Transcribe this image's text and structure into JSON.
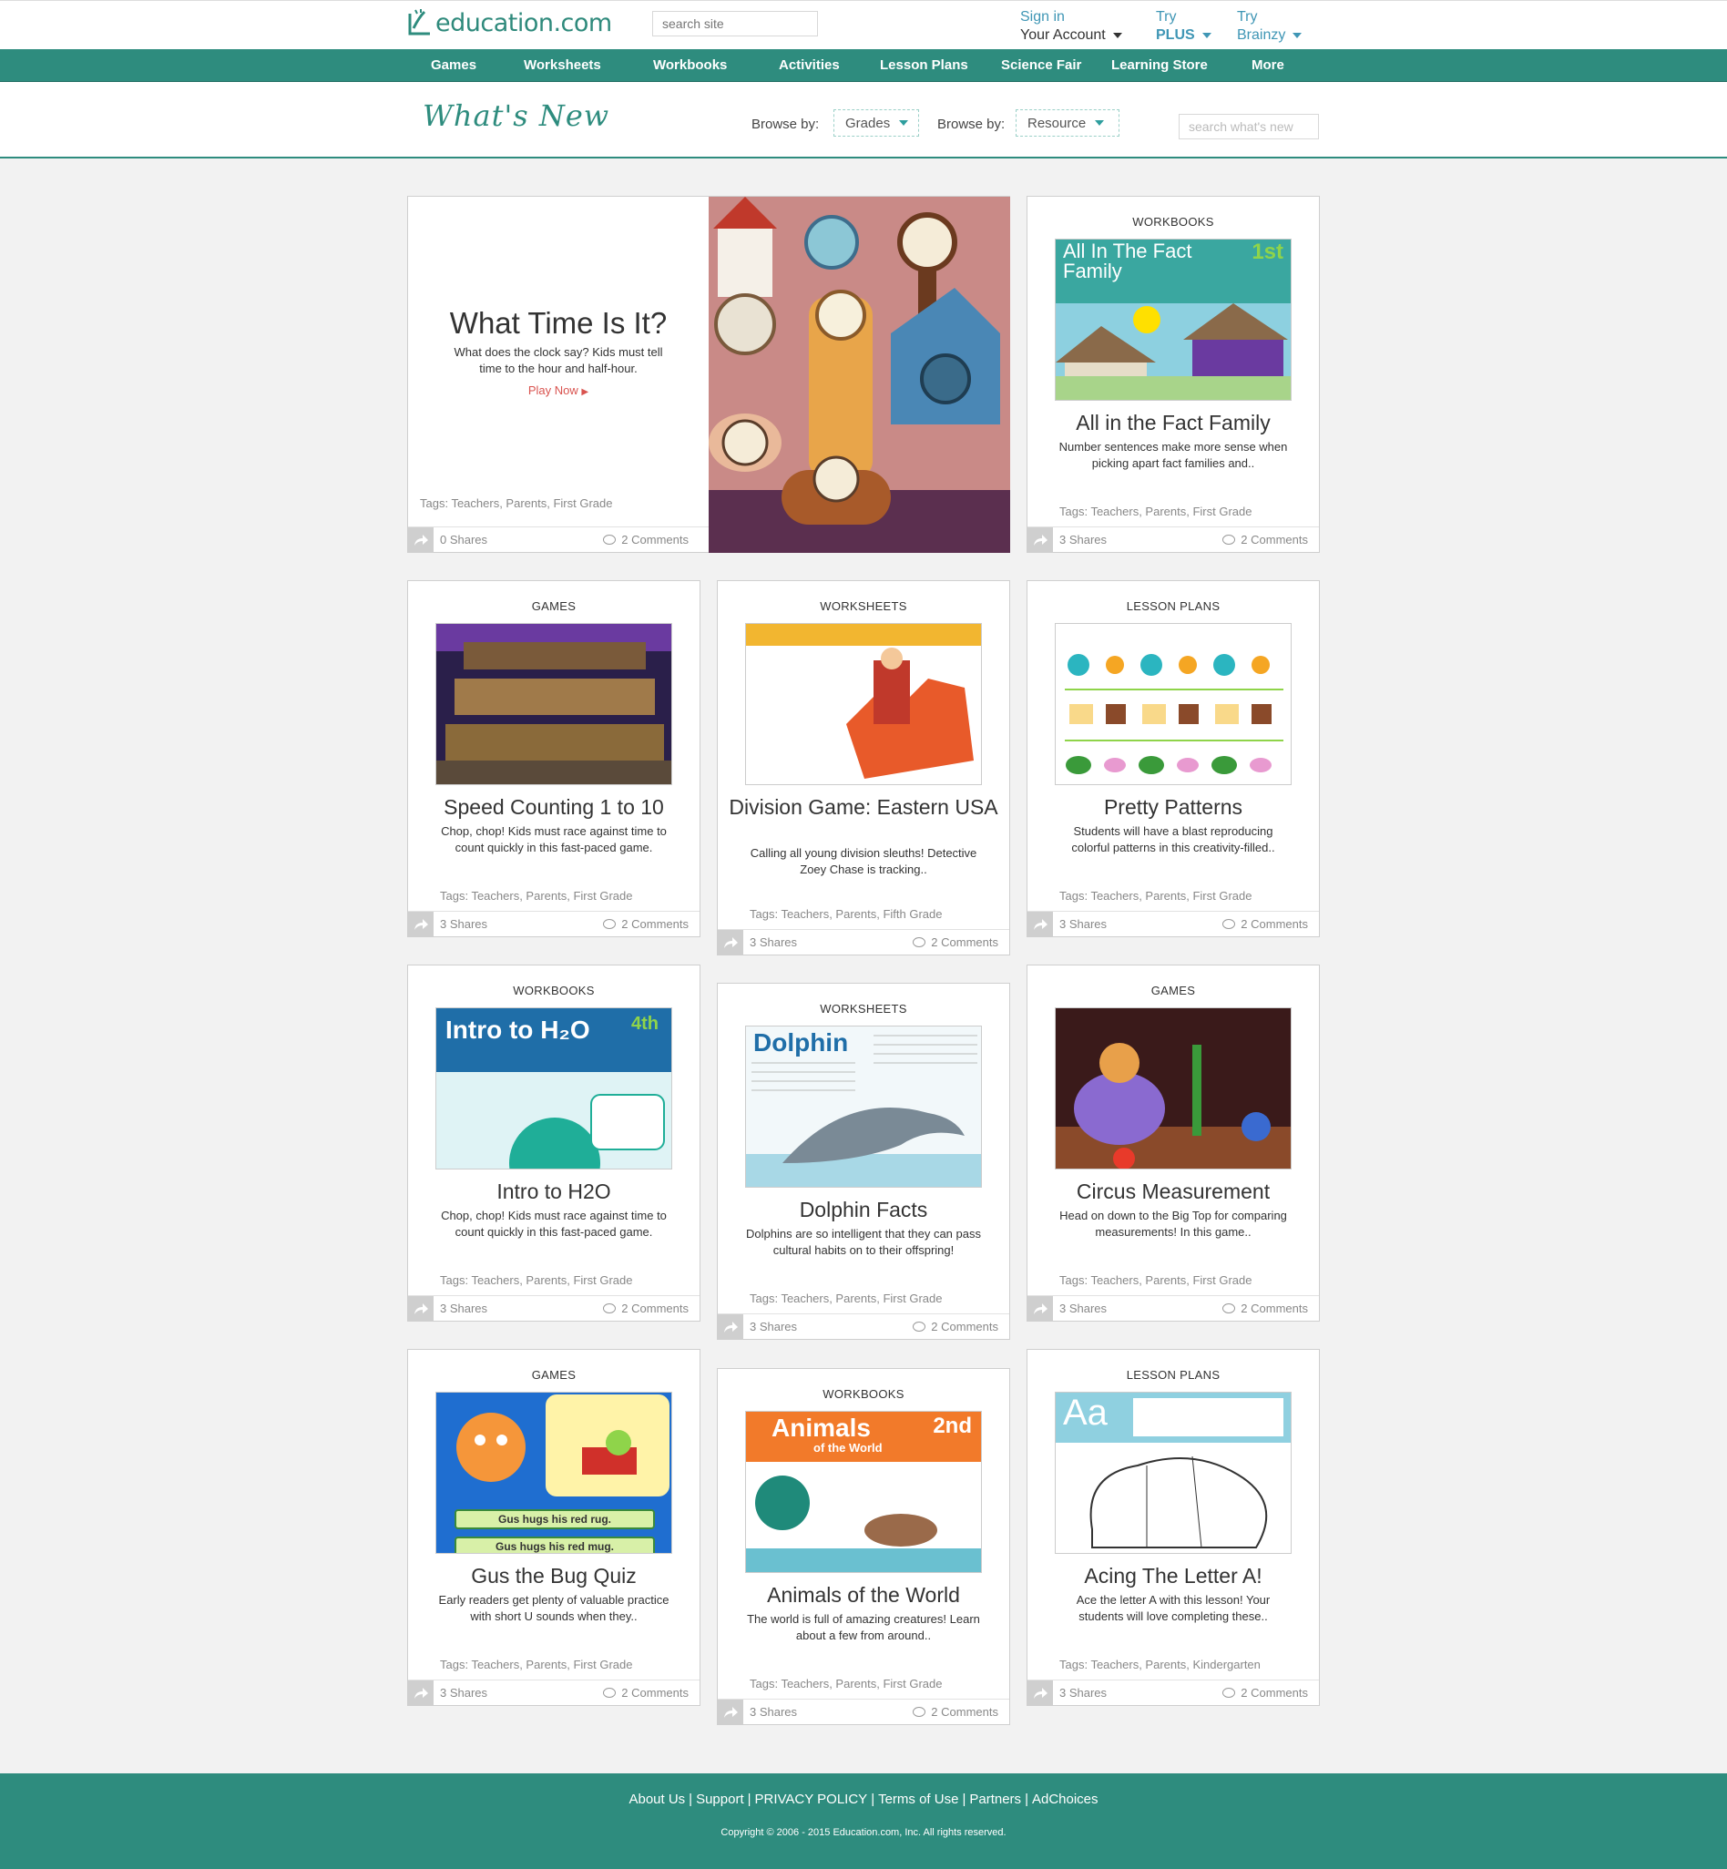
{
  "header": {
    "logo_text": "education.com",
    "search_placeholder": "search site",
    "sign_in": "Sign in",
    "your_account": "Your Account",
    "try_plus_1": "Try",
    "try_plus_2": "PLUS",
    "try_brainzy_1": "Try",
    "try_brainzy_2": "Brainzy"
  },
  "nav": {
    "items": [
      "Games",
      "Worksheets",
      "Workbooks",
      "Activities",
      "Lesson Plans",
      "Science Fair",
      "Learning Store",
      "More"
    ]
  },
  "whats_new": {
    "title": "What's New",
    "browse_label_1": "Browse  by:",
    "grades": "Grades",
    "browse_label_2": "Browse  by:",
    "resource": "Resource",
    "search_placeholder": "search what's new"
  },
  "featured": {
    "title": "What Time Is It?",
    "desc": "What does the clock say? Kids must tell time to the hour and half-hour.",
    "play": "Play Now",
    "tags": "Tags: Teachers, Parents, First Grade",
    "shares": "0 Shares",
    "comments": "2 Comments"
  },
  "cards": [
    {
      "category": "WORKBOOKS",
      "title": "All in the Fact Family",
      "desc": "Number sentences make more sense when picking apart fact families and..",
      "tags": "Tags: Teachers, Parents, First Grade",
      "shares": "3 Shares",
      "comments": "2 Comments",
      "thumb_text": "All In The Fact Family",
      "thumb_badge": "1st"
    },
    {
      "category": "GAMES",
      "title": "Speed Counting 1 to 10",
      "desc": "Chop, chop! Kids must race against time to count quickly in this fast-paced game.",
      "tags": "Tags: Teachers, Parents, First Grade",
      "shares": "3 Shares",
      "comments": "2 Comments"
    },
    {
      "category": "WORKSHEETS",
      "title": "Division Game: Eastern USA",
      "desc": "Calling all young division sleuths! Detective Zoey Chase is tracking..",
      "tags": "Tags: Teachers, Parents, Fifth Grade",
      "shares": "3 Shares",
      "comments": "2 Comments"
    },
    {
      "category": "LESSON PLANS",
      "title": "Pretty Patterns",
      "desc": "Students will have a blast reproducing colorful patterns in this creativity-filled..",
      "tags": "Tags: Teachers, Parents, First Grade",
      "shares": "3 Shares",
      "comments": "2 Comments"
    },
    {
      "category": "WORKBOOKS",
      "title": "Intro to H2O",
      "desc": "Chop, chop! Kids must race against time to count quickly in this fast-paced game.",
      "tags": "Tags: Teachers, Parents, First Grade",
      "shares": "3 Shares",
      "comments": "2 Comments",
      "thumb_text": "Intro to H₂O",
      "thumb_badge": "4th"
    },
    {
      "category": "WORKSHEETS",
      "title": "Dolphin Facts",
      "desc": "Dolphins are so intelligent that they can pass cultural habits on to their offspring!",
      "tags": "Tags: Teachers, Parents, First Grade",
      "shares": "3 Shares",
      "comments": "2 Comments",
      "thumb_text": "Dolphin"
    },
    {
      "category": "GAMES",
      "title": "Circus Measurement",
      "desc": "Head on down to the Big Top for comparing measurements! In this game..",
      "tags": "Tags: Teachers, Parents, First Grade",
      "shares": "3 Shares",
      "comments": "2 Comments"
    },
    {
      "category": "GAMES",
      "title": "Gus the Bug Quiz",
      "desc": "Early readers get plenty of valuable practice with short U sounds when they..",
      "tags": "Tags: Teachers, Parents, First Grade",
      "shares": "3 Shares",
      "comments": "2 Comments",
      "thumb_text": "Gus hugs his red rug.",
      "thumb_text2": "Gus hugs his red mug."
    },
    {
      "category": "WORKBOOKS",
      "title": "Animals of the World",
      "desc": "The world is full of amazing creatures! Learn about a few from around..",
      "tags": "Tags: Teachers, Parents, First Grade",
      "shares": "3 Shares",
      "comments": "2 Comments",
      "thumb_text": "Animals",
      "thumb_text2": "of the World",
      "thumb_badge": "2nd"
    },
    {
      "category": "LESSON PLANS",
      "title": "Acing The Letter A!",
      "desc": "Ace the letter A with this lesson! Your students will love completing these..",
      "tags": "Tags: Teachers, Parents, Kindergarten",
      "shares": "3 Shares",
      "comments": "2 Comments",
      "thumb_text": "Aa"
    }
  ],
  "footer": {
    "links": [
      "About Us",
      "Support",
      "PRIVACY POLICY",
      "Terms of Use",
      "Partners",
      "AdChoices"
    ],
    "copyright": "Copyright © 2006 - 2015 Education.com, Inc. All rights reserved."
  },
  "colors": {
    "brand": "#2e8c7e",
    "link": "#3f96b5",
    "play": "#d9534f"
  }
}
